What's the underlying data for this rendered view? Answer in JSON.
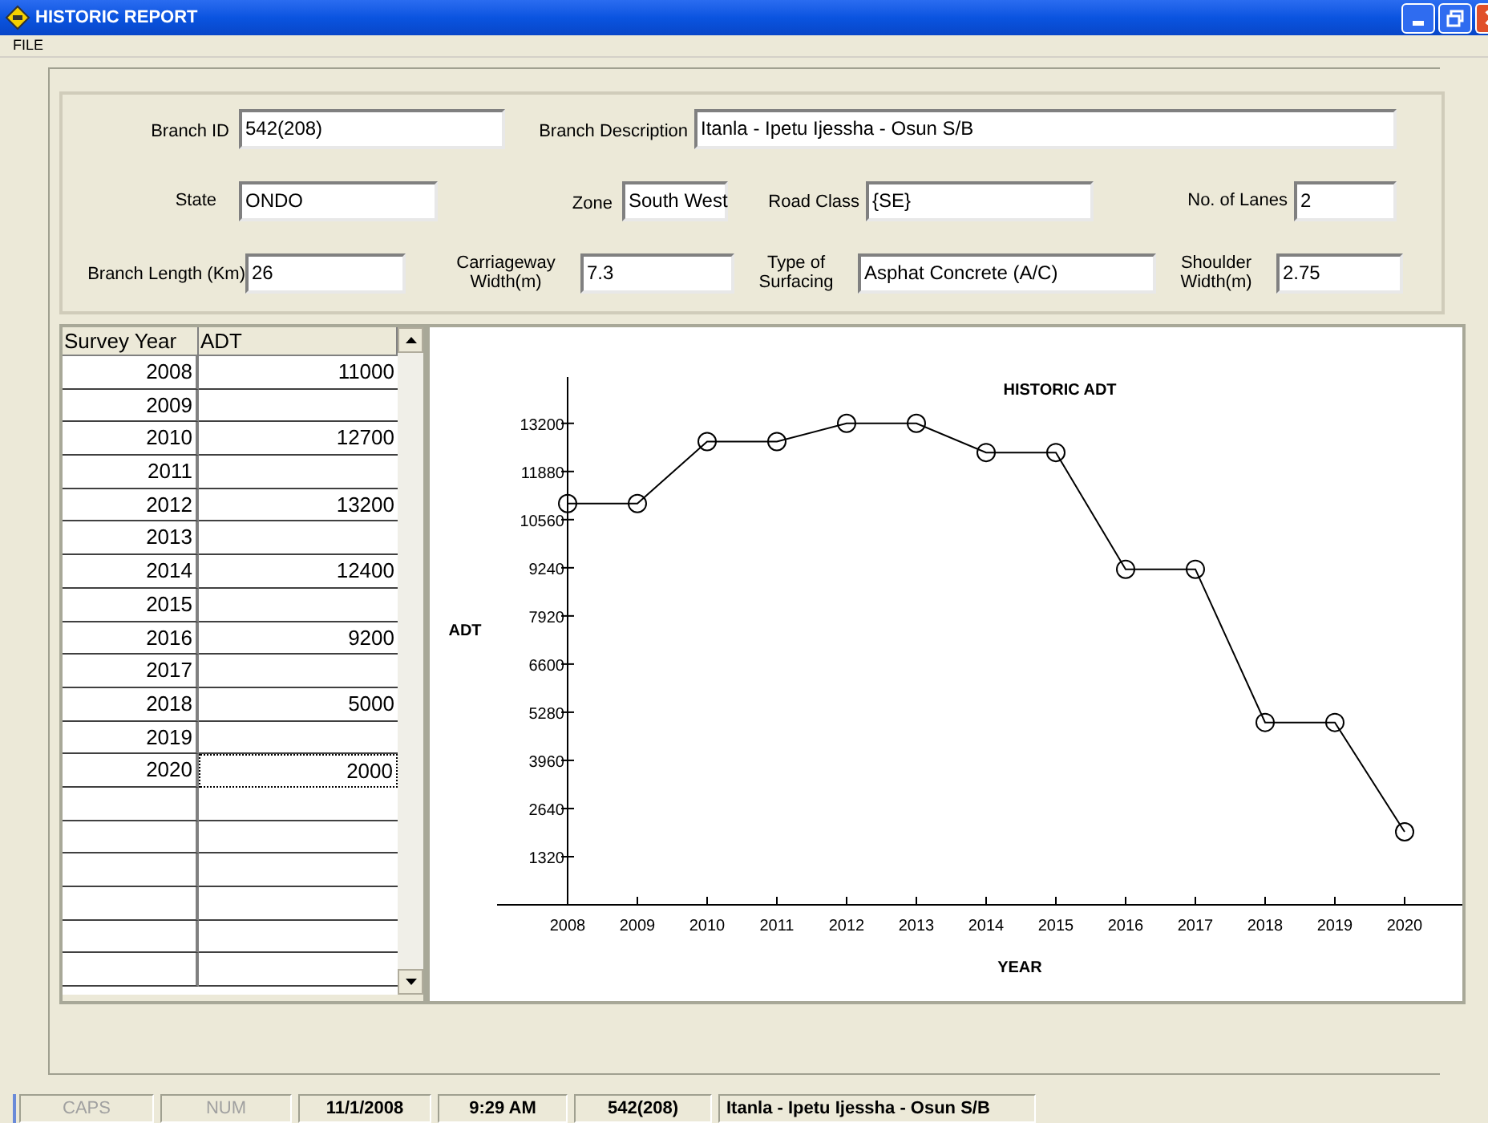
{
  "window": {
    "title": "HISTORIC REPORT"
  },
  "menu": [
    "FILE"
  ],
  "form": {
    "rows": [
      [
        {
          "label": "Branch ID",
          "value": "542(208)"
        },
        {
          "label": "Branch Description",
          "value": "Itanla - Ipetu Ijessha - Osun S/B"
        }
      ],
      [
        {
          "label": "State",
          "value": "ONDO"
        },
        {
          "label": "Zone",
          "value": "South West"
        },
        {
          "label": "Road Class",
          "value": "{SE}"
        },
        {
          "label": "No. of Lanes",
          "value": "2"
        }
      ],
      [
        {
          "label": "Branch Length (Km)",
          "value": "26"
        },
        {
          "label": "Carriageway Width(m)",
          "value": "7.3"
        },
        {
          "label": "Type of Surfacing",
          "value": "Asphat Concrete (A/C)"
        },
        {
          "label": "Shoulder Width(m)",
          "value": "2.75"
        }
      ]
    ]
  },
  "grid": {
    "columns": [
      "Survey Year",
      "ADT"
    ],
    "rows": [
      {
        "year": "2008",
        "adt": "11000",
        "focused": false
      },
      {
        "year": "2009",
        "focused": false
      },
      {
        "year": "2010",
        "adt": "12700",
        "focused": false
      },
      {
        "year": "2011",
        "focused": false
      },
      {
        "year": "2012",
        "adt": "13200",
        "focused": false
      },
      {
        "year": "2013",
        "focused": false
      },
      {
        "year": "2014",
        "adt": "12400",
        "focused": false
      },
      {
        "year": "2015",
        "focused": false
      },
      {
        "year": "2016",
        "adt": "9200",
        "focused": false
      },
      {
        "year": "2017",
        "focused": false
      },
      {
        "year": "2018",
        "adt": "5000",
        "focused": false
      },
      {
        "year": "2019",
        "focused": false
      },
      {
        "year": "2020",
        "adt": "2000",
        "focused": true
      }
    ]
  },
  "chart": {
    "chart_data": {
      "type": "line",
      "title": "HISTORIC ADT",
      "xlabel": "YEAR",
      "ylabel": "ADT",
      "categories": [
        "2008",
        "2009",
        "2010",
        "2011",
        "2012",
        "2013",
        "2014",
        "2015",
        "2016",
        "2017",
        "2018",
        "2019",
        "2020"
      ],
      "series": [
        {
          "color": "#000000",
          "marker": "circle",
          "values": [
            11000,
            11000,
            12700,
            12700,
            13200,
            13200,
            12400,
            12400,
            9200,
            9200,
            5000,
            5000,
            2000
          ]
        }
      ],
      "ylim": [
        0,
        14470
      ],
      "yticks": [
        1320,
        2640,
        3960,
        5280,
        6600,
        7920,
        9240,
        10560,
        11880,
        13200
      ]
    }
  },
  "status_bar": [
    {
      "text": "CAPS",
      "active": false
    },
    {
      "text": "NUM",
      "active": false
    },
    {
      "text": "11/1/2008",
      "active": true
    },
    {
      "text": "9:29 AM",
      "active": true
    },
    {
      "text": "542(208)",
      "active": true
    },
    {
      "text": "Itanla - Ipetu Ijessha - Osun S/B",
      "active": true
    }
  ]
}
